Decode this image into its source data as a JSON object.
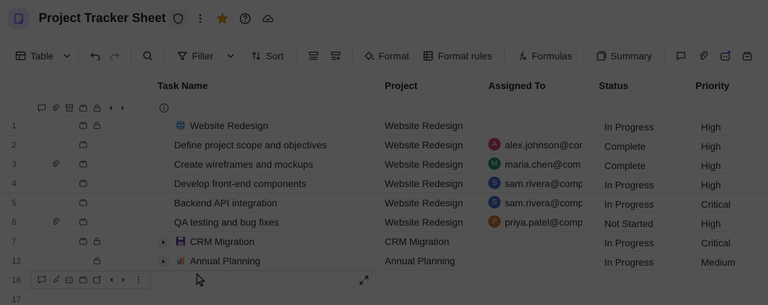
{
  "header": {
    "title": "Project Tracker Sheet"
  },
  "toolbar": {
    "view_label": "Table",
    "filter_label": "Filter",
    "sort_label": "Sort",
    "format_label": "Format",
    "format_rules_label": "Format rules",
    "formulas_label": "Formulas",
    "summary_label": "Summary"
  },
  "columns": {
    "task": "Task Name",
    "project": "Project",
    "assigned": "Assigned To",
    "status": "Status",
    "priority": "Priority"
  },
  "rows": [
    {
      "num": "1",
      "task": "Website Redesign",
      "project": "Website Redesign",
      "assigned": "",
      "avatar": "",
      "status": "In Progress",
      "priority": "High"
    },
    {
      "num": "2",
      "task": "Define project scope and objectives",
      "project": "Website Redesign",
      "assigned": "alex.johnson@cor",
      "avatar": "A",
      "status": "Complete",
      "priority": "High"
    },
    {
      "num": "3",
      "task": "Create wireframes and mockups",
      "project": "Website Redesign",
      "assigned": "maria.chen@com",
      "avatar": "M",
      "status": "Complete",
      "priority": "High"
    },
    {
      "num": "4",
      "task": "Develop front-end components",
      "project": "Website Redesign",
      "assigned": "sam.rivera@comp",
      "avatar": "S",
      "status": "In Progress",
      "priority": "High"
    },
    {
      "num": "5",
      "task": "Backend API integration",
      "project": "Website Redesign",
      "assigned": "sam.rivera@comp",
      "avatar": "S",
      "status": "In Progress",
      "priority": "Critical"
    },
    {
      "num": "6",
      "task": "QA testing and bug fixes",
      "project": "Website Redesign",
      "assigned": "priya.patel@comp",
      "avatar": "P",
      "status": "Not Started",
      "priority": "High"
    },
    {
      "num": "7",
      "task": "CRM Migration",
      "project": "CRM Migration",
      "assigned": "",
      "avatar": "",
      "status": "In Progress",
      "priority": "Critical"
    },
    {
      "num": "12",
      "task": "Annual Planning",
      "project": "Annual Planning",
      "assigned": "",
      "avatar": "",
      "status": "In Progress",
      "priority": "Medium"
    },
    {
      "num": "16",
      "task": "",
      "project": "",
      "assigned": "",
      "avatar": "",
      "status": "",
      "priority": ""
    },
    {
      "num": "17",
      "task": "",
      "project": "",
      "assigned": "",
      "avatar": "",
      "status": "",
      "priority": ""
    }
  ],
  "colors": {
    "accent": "#7b4cff",
    "avatar_a": "#d9486b",
    "avatar_m": "#1f9d6b",
    "avatar_s": "#4a6fd6",
    "avatar_p": "#e07a2e",
    "star": "#f2b400"
  }
}
